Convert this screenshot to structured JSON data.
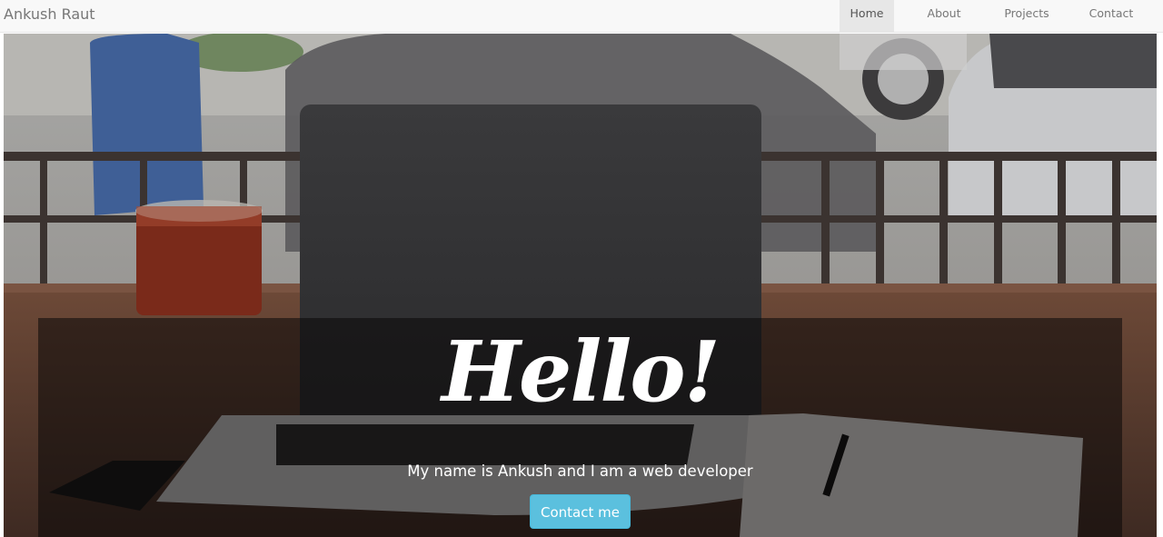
{
  "navbar": {
    "brand": "Ankush Raut",
    "items": [
      {
        "label": "Home",
        "active": true
      },
      {
        "label": "About",
        "active": false
      },
      {
        "label": "Projects",
        "active": false
      },
      {
        "label": "Contact",
        "active": false
      }
    ]
  },
  "hero": {
    "heading": "Hello!",
    "tagline": "My name is Ankush and I am a web developer",
    "cta_label": "Contact me"
  },
  "colors": {
    "navbar_bg": "#f8f8f8",
    "nav_active_bg": "#e7e7e7",
    "nav_text": "#777777",
    "button_bg": "#5bc0de",
    "heading_text": "#ffffff"
  },
  "icons": {
    "background_image": "laptop-cafe-photo"
  }
}
